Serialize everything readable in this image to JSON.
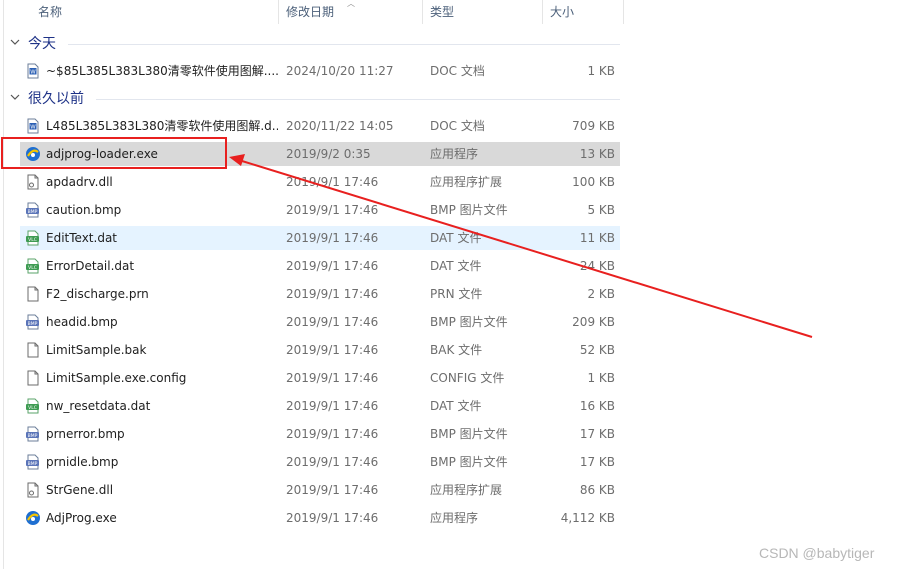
{
  "columns": {
    "name": "名称",
    "date": "修改日期",
    "type": "类型",
    "size": "大小"
  },
  "groups": [
    {
      "label": "今天"
    },
    {
      "label": "很久以前"
    }
  ],
  "files": [
    {
      "name": "~$85L385L383L380清零软件使用图解....",
      "date": "2024/10/20 11:27",
      "type": "DOC 文档",
      "size": "1 KB",
      "icon": "word-doc-icon"
    },
    {
      "name": "L485L385L383L380清零软件使用图解.d...",
      "date": "2020/11/22 14:05",
      "type": "DOC 文档",
      "size": "709 KB",
      "icon": "word-doc-icon"
    },
    {
      "name": "adjprog-loader.exe",
      "date": "2019/9/2 0:35",
      "type": "应用程序",
      "size": "13 KB",
      "icon": "app-exe-icon"
    },
    {
      "name": "apdadrv.dll",
      "date": "2019/9/1 17:46",
      "type": "应用程序扩展",
      "size": "100 KB",
      "icon": "dll-icon"
    },
    {
      "name": "caution.bmp",
      "date": "2019/9/1 17:46",
      "type": "BMP 图片文件",
      "size": "5 KB",
      "icon": "bmp-icon"
    },
    {
      "name": "EditText.dat",
      "date": "2019/9/1 17:46",
      "type": "DAT 文件",
      "size": "11 KB",
      "icon": "vlc-dat-icon"
    },
    {
      "name": "ErrorDetail.dat",
      "date": "2019/9/1 17:46",
      "type": "DAT 文件",
      "size": "24 KB",
      "icon": "vlc-dat-icon"
    },
    {
      "name": "F2_discharge.prn",
      "date": "2019/9/1 17:46",
      "type": "PRN 文件",
      "size": "2 KB",
      "icon": "blank-file-icon"
    },
    {
      "name": "headid.bmp",
      "date": "2019/9/1 17:46",
      "type": "BMP 图片文件",
      "size": "209 KB",
      "icon": "bmp-icon"
    },
    {
      "name": "LimitSample.bak",
      "date": "2019/9/1 17:46",
      "type": "BAK 文件",
      "size": "52 KB",
      "icon": "blank-file-icon"
    },
    {
      "name": "LimitSample.exe.config",
      "date": "2019/9/1 17:46",
      "type": "CONFIG 文件",
      "size": "1 KB",
      "icon": "blank-file-icon"
    },
    {
      "name": "nw_resetdata.dat",
      "date": "2019/9/1 17:46",
      "type": "DAT 文件",
      "size": "16 KB",
      "icon": "vlc-dat-icon"
    },
    {
      "name": "prnerror.bmp",
      "date": "2019/9/1 17:46",
      "type": "BMP 图片文件",
      "size": "17 KB",
      "icon": "bmp-icon"
    },
    {
      "name": "prnidle.bmp",
      "date": "2019/9/1 17:46",
      "type": "BMP 图片文件",
      "size": "17 KB",
      "icon": "bmp-icon"
    },
    {
      "name": "StrGene.dll",
      "date": "2019/9/1 17:46",
      "type": "应用程序扩展",
      "size": "86 KB",
      "icon": "dll-icon"
    },
    {
      "name": "AdjProg.exe",
      "date": "2019/9/1 17:46",
      "type": "应用程序",
      "size": "4,112 KB",
      "icon": "app-exe-icon"
    }
  ],
  "watermark": "CSDN @babytiger",
  "colors": {
    "annotation": "#e8201f",
    "selected_row": "#d9d9d9",
    "hover_row": "#e5f3ff",
    "group_text": "#1e3287"
  }
}
